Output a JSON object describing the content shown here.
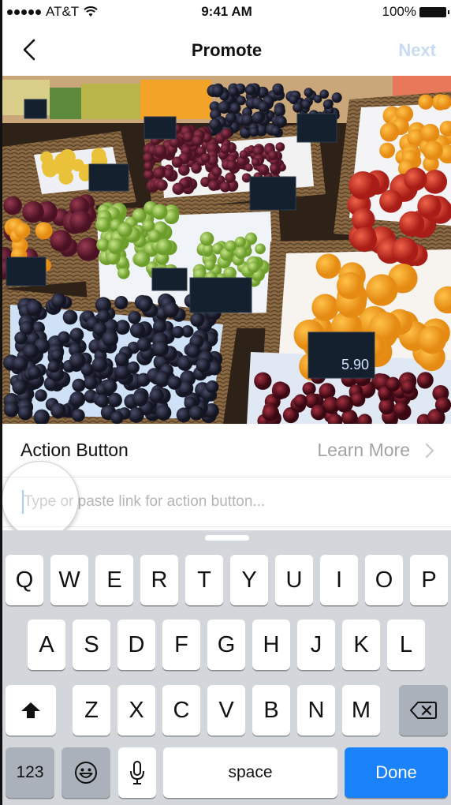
{
  "status_bar": {
    "signal_dots": 5,
    "carrier": "AT&T",
    "wifi_icon": "wifi-icon",
    "time": "9:41 AM",
    "battery_percent": "100%",
    "battery_level": 1.0
  },
  "nav": {
    "back_icon": "chevron-left-icon",
    "title": "Promote",
    "next_label": "Next",
    "next_enabled": false
  },
  "photo": {
    "description": "Fruit market stalls with baskets of grapes, oranges, apples, bananas and cherries",
    "price_tag_text": "5.90"
  },
  "action_button_row": {
    "label": "Action Button",
    "value": "Learn More",
    "chevron_icon": "chevron-right-icon"
  },
  "link_field": {
    "value": "",
    "placeholder": "Type or paste link for action button..."
  },
  "keyboard": {
    "row1": [
      "Q",
      "W",
      "E",
      "R",
      "T",
      "Y",
      "U",
      "I",
      "O",
      "P"
    ],
    "row2": [
      "A",
      "S",
      "D",
      "F",
      "G",
      "H",
      "J",
      "K",
      "L"
    ],
    "row3": [
      "Z",
      "X",
      "C",
      "V",
      "B",
      "N",
      "M"
    ],
    "shift_icon": "shift-arrow-icon",
    "delete_icon": "backspace-icon",
    "numbers_label": "123",
    "emoji_icon": "emoji-icon",
    "mic_icon": "microphone-icon",
    "space_label": "space",
    "done_label": "Done",
    "accent_color": "#1a82fb"
  }
}
